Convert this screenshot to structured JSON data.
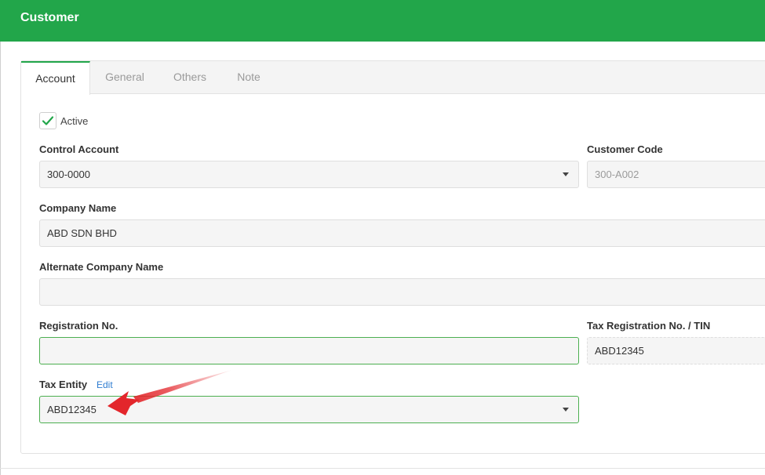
{
  "header": {
    "title": "Customer"
  },
  "tabs": [
    {
      "label": "Account",
      "active": true
    },
    {
      "label": "General",
      "active": false
    },
    {
      "label": "Others",
      "active": false
    },
    {
      "label": "Note",
      "active": false
    }
  ],
  "form": {
    "active": {
      "label": "Active",
      "checked": true
    },
    "control_account": {
      "label": "Control Account",
      "value": "300-0000"
    },
    "customer_code": {
      "label": "Customer Code",
      "value": "300-A002"
    },
    "company_name": {
      "label": "Company Name",
      "value": "ABD SDN BHD"
    },
    "alternate_company_name": {
      "label": "Alternate Company Name",
      "value": ""
    },
    "registration_no": {
      "label": "Registration No.",
      "value": ""
    },
    "tax_registration": {
      "label": "Tax Registration No. / TIN",
      "value": "ABD12345"
    },
    "tax_entity": {
      "label": "Tax Entity",
      "edit_label": "Edit",
      "value": "ABD12345"
    }
  },
  "colors": {
    "header": "#22a64a",
    "accent": "#22a64a",
    "link": "#2f7dd1",
    "arrow": "#e3262b"
  },
  "icons": {
    "checkbox_check": "check-icon",
    "dropdown": "caret-down-icon",
    "annotation": "red-arrow-icon"
  }
}
